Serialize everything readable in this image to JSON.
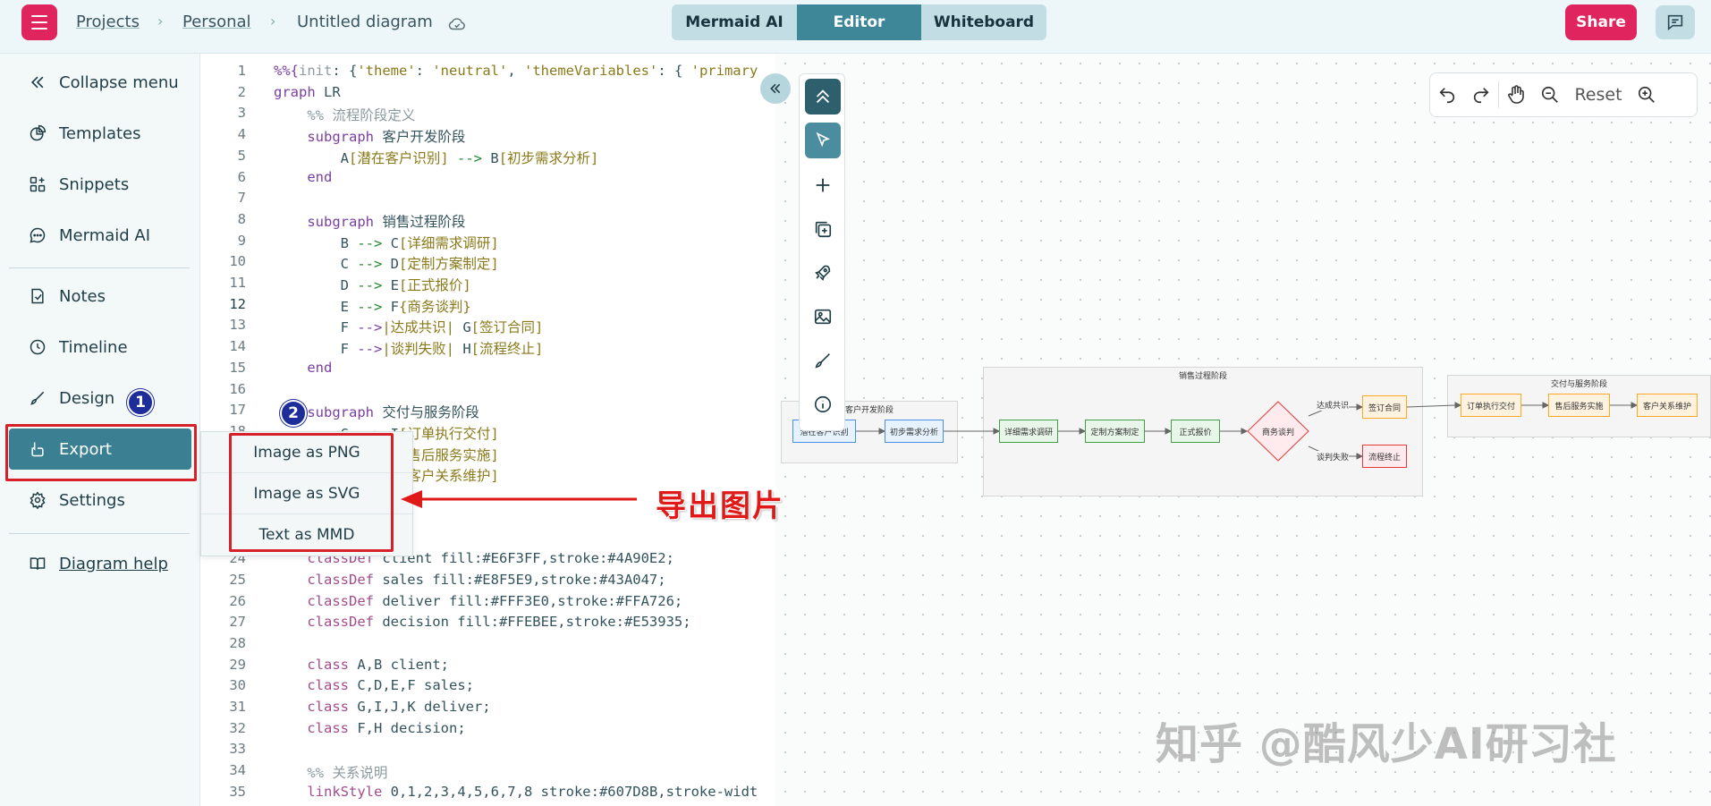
{
  "header": {
    "breadcrumb": {
      "projects": "Projects",
      "personal": "Personal",
      "title": "Untitled diagram",
      "separator": "›"
    },
    "modes": [
      {
        "label": "Mermaid AI",
        "active": false
      },
      {
        "label": "Editor",
        "active": true
      },
      {
        "label": "Whiteboard",
        "active": false
      }
    ],
    "share_label": "Share"
  },
  "sidebar": {
    "items": [
      {
        "label": "Collapse menu",
        "icon": "double-chevron-left-icon"
      },
      {
        "label": "Templates",
        "icon": "templates-icon"
      },
      {
        "label": "Snippets",
        "icon": "snippets-icon"
      },
      {
        "label": "Mermaid AI",
        "icon": "chat-bubble-icon"
      },
      {
        "label": "Notes",
        "icon": "notes-icon"
      },
      {
        "label": "Timeline",
        "icon": "clock-icon"
      },
      {
        "label": "Design",
        "icon": "brush-icon"
      },
      {
        "label": "Export",
        "icon": "export-icon",
        "active": true
      },
      {
        "label": "Settings",
        "icon": "gear-icon"
      },
      {
        "label": "Diagram help",
        "icon": "book-icon"
      }
    ]
  },
  "export_menu": {
    "options": [
      "Image as PNG",
      "Image as SVG",
      "Text as MMD"
    ]
  },
  "annotations": {
    "badge1": "1",
    "badge2": "2",
    "callout": "导出图片",
    "watermark": "知乎 @酷风少AI研习社"
  },
  "zoom": {
    "reset_label": "Reset"
  },
  "editor": {
    "lines": [
      {
        "n": "1",
        "html": "<span class=\"kw\">%%{</span><span class=\"cm\">init</span>: {<span class=\"str\">'theme'</span>: <span class=\"str\">'neutral'</span>, <span class=\"str\">'themeVariables'</span>: { <span class=\"str\">'primary</span>"
      },
      {
        "n": "2",
        "html": "<span class=\"kw\">graph</span> LR"
      },
      {
        "n": "3",
        "html": "    <span class=\"cm\">%% 流程阶段定义</span>"
      },
      {
        "n": "4",
        "html": "    <span class=\"kw\">subgraph</span> 客户开发阶段"
      },
      {
        "n": "5",
        "html": "        A<span class=\"str\">[潜在客户识别]</span> <span class=\"ar\">--></span> B<span class=\"str\">[初步需求分析]</span>"
      },
      {
        "n": "6",
        "html": "    <span class=\"kw\">end</span>"
      },
      {
        "n": "7",
        "html": ""
      },
      {
        "n": "8",
        "html": "    <span class=\"kw\">subgraph</span> 销售过程阶段"
      },
      {
        "n": "9",
        "html": "        B <span class=\"ar\">--></span> C<span class=\"str\">[详细需求调研]</span>"
      },
      {
        "n": "10",
        "html": "        C <span class=\"ar\">--></span> D<span class=\"str\">[定制方案制定]</span>"
      },
      {
        "n": "11",
        "html": "        D <span class=\"ar\">--></span> E<span class=\"str\">[正式报价]</span>"
      },
      {
        "n": "12",
        "html": "        E <span class=\"ar\">--></span> F<span class=\"str\">{商务谈判}</span>"
      },
      {
        "n": "13",
        "html": "        F <span class=\"arp\">--></span><span class=\"str\">|达成共识|</span> G<span class=\"str\">[签订合同]</span>"
      },
      {
        "n": "14",
        "html": "        F <span class=\"arp\">--></span><span class=\"str\">|谈判失败|</span> H<span class=\"str\">[流程终止]</span>"
      },
      {
        "n": "15",
        "html": "    <span class=\"kw\">end</span>"
      },
      {
        "n": "16",
        "html": ""
      },
      {
        "n": "17",
        "html": "    <span class=\"kw\">subgraph</span> 交付与服务阶段"
      },
      {
        "n": "18",
        "html": "        G <span class=\"ar\">--></span> I<span class=\"str\">[订单执行交付]</span>"
      },
      {
        "n": "19",
        "html": "        I <span class=\"ar\">--></span> J<span class=\"str\">[售后服务实施]</span>"
      },
      {
        "n": "20",
        "html": "        J <span class=\"ar\">--></span> K<span class=\"str\">[客户关系维护]</span>"
      },
      {
        "n": "24",
        "html": "    <span class=\"nm\">classDef</span> client fill:#E6F3FF,stroke:#4A90E2;"
      },
      {
        "n": "25",
        "html": "    <span class=\"nm\">classDef</span> sales fill:#E8F5E9,stroke:#43A047;"
      },
      {
        "n": "26",
        "html": "    <span class=\"nm\">classDef</span> deliver fill:#FFF3E0,stroke:#FFA726;"
      },
      {
        "n": "27",
        "html": "    <span class=\"nm\">classDef</span> decision fill:#FFEBEE,stroke:#E53935;"
      },
      {
        "n": "28",
        "html": ""
      },
      {
        "n": "29",
        "html": "    <span class=\"nm\">class</span> A,B client;"
      },
      {
        "n": "30",
        "html": "    <span class=\"nm\">class</span> C,D,E,F sales;"
      },
      {
        "n": "31",
        "html": "    <span class=\"nm\">class</span> G,I,J,K deliver;"
      },
      {
        "n": "32",
        "html": "    <span class=\"nm\">class</span> F,H decision;"
      },
      {
        "n": "33",
        "html": ""
      },
      {
        "n": "34",
        "html": "    <span class=\"cm\">%% 关系说明</span>"
      },
      {
        "n": "35",
        "html": "    <span class=\"nm\">linkStyle</span> 0,1,2,3,4,5,6,7,8 stroke:#607D8B,stroke-widt"
      }
    ]
  },
  "diagram": {
    "subgraphs": [
      "客户开发阶段",
      "销售过程阶段",
      "交付与服务阶段"
    ],
    "nodes": {
      "A": "潜在客户识别",
      "B": "初步需求分析",
      "C": "详细需求调研",
      "D": "定制方案制定",
      "E": "正式报价",
      "F": "商务谈判",
      "G": "签订合同",
      "H": "流程终止",
      "I": "订单执行交付",
      "J": "售后服务实施",
      "K": "客户关系维护"
    },
    "edge_labels": [
      "达成共识",
      "谈判失败"
    ]
  }
}
